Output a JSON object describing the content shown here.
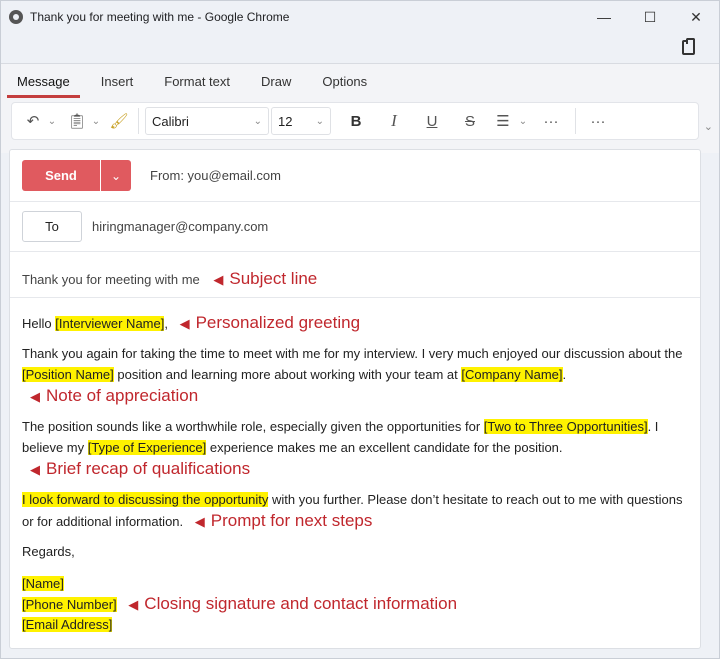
{
  "window": {
    "title": "Thank you for meeting with me - Google Chrome",
    "minimize": "—",
    "maximize": "☐",
    "close": "✕"
  },
  "ribbon": {
    "tabs": [
      "Message",
      "Insert",
      "Format text",
      "Draw",
      "Options"
    ],
    "font_name": "Calibri",
    "font_size": "12",
    "bold": "B",
    "italic": "I",
    "underline": "U",
    "strike": "S",
    "more": "···"
  },
  "compose": {
    "send_label": "Send",
    "from": "From: you@email.com",
    "to_label": "To",
    "to_value": "hiringmanager@company.com",
    "subject": "Thank you for meeting with me"
  },
  "annotations": {
    "subject": "Subject line",
    "greeting": "Personalized greeting",
    "appreciation": "Note of appreciation",
    "recap": "Brief recap of qualifications",
    "next_steps": "Prompt for next steps",
    "closing": "Closing signature and contact information"
  },
  "email_body": {
    "greeting_prefix": "Hello ",
    "interviewer_name": "[Interviewer Name]",
    "greeting_suffix": ",",
    "p1_a": "Thank you again for taking the time to meet with me for my interview. I very much enjoyed our discussion about the ",
    "position_name": "[Position Name]",
    "p1_b": " position and learning more about working with your team at ",
    "company_name": "[Company Name]",
    "p1_c": ".",
    "p2_a": "The position sounds like a worthwhile role, especially given the opportunities for ",
    "opportunities": "[Two to Three Opportunities]",
    "p2_b": ". I believe my ",
    "experience_type": "[Type of Experience]",
    "p2_c": " experience makes me an excellent candidate for the position.",
    "p3_highlight": "I look forward to discussing the opportunity",
    "p3_b": " with you further. Please don’t hesitate to reach out to me with questions or for additional information.",
    "regards": "Regards,",
    "sig_name": "[Name]",
    "sig_phone": "[Phone Number]",
    "sig_email": "[Email Address]"
  },
  "colors": {
    "send": "#e05a5f",
    "annotation": "#c0272d",
    "highlight": "#fff200",
    "active_tab_underline": "#c43e3e"
  }
}
